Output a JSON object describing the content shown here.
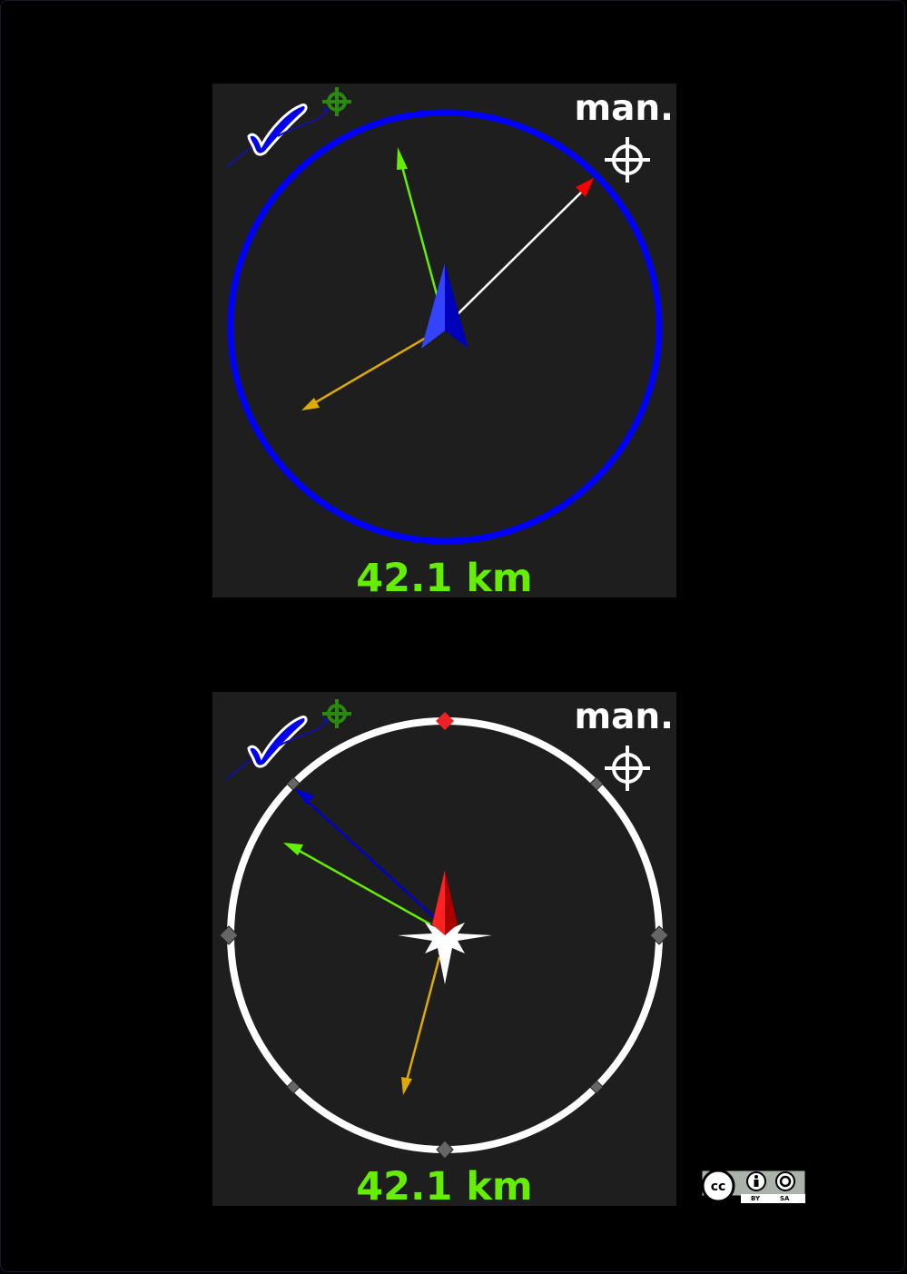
{
  "panels": [
    {
      "mode_label": "man.",
      "distance": "42.1 km",
      "ring_color": "#0000ff",
      "icons": [
        "check-icon",
        "gps-target-icon",
        "crosshair-icon",
        "blue-direction-arrow-icon"
      ]
    },
    {
      "mode_label": "man.",
      "distance": "42.1 km",
      "ring_color": "#ffffff",
      "icons": [
        "check-icon",
        "gps-target-icon",
        "crosshair-icon",
        "compass-rose-icon",
        "red-north-needle-icon"
      ]
    }
  ],
  "license": {
    "cc": "cc",
    "by": "BY",
    "sa": "SA"
  },
  "colors": {
    "background": "#000000",
    "panel": "#1e1e1e",
    "distance_text": "#66ee00",
    "green_arrow": "#66ee00",
    "orange_arrow": "#ddaa00",
    "red_arrow": "#ff0000",
    "blue_ring": "#0000ff",
    "white_ring": "#ffffff"
  }
}
